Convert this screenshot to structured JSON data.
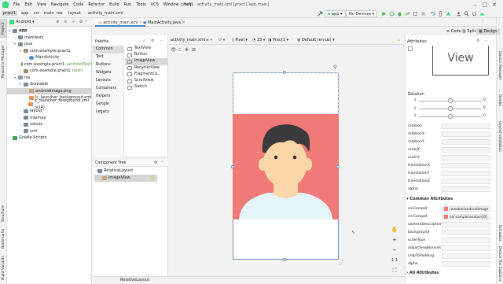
{
  "menu": [
    "File",
    "Edit",
    "View",
    "Navigate",
    "Code",
    "Refactor",
    "Build",
    "Run",
    "Tools",
    "VCS",
    "Window",
    "Help"
  ],
  "window_title": "pract1 - activity_main.xml [pract1.app.main]",
  "breadcrumbs": [
    "pract1",
    "app",
    "src",
    "main",
    "res",
    "layout",
    "activity_main.xml"
  ],
  "toolbar": {
    "run_config": "app",
    "device": "No Devices"
  },
  "project": {
    "view_mode": "Android",
    "tree": [
      {
        "label": "app",
        "indent": 0,
        "icon": "folder",
        "arrow": "▾",
        "bold": true
      },
      {
        "label": "manifests",
        "indent": 1,
        "icon": "folder",
        "arrow": "›"
      },
      {
        "label": "java",
        "indent": 1,
        "icon": "folder",
        "arrow": "▾"
      },
      {
        "label": "com.example.pract1",
        "indent": 2,
        "icon": "pkg",
        "arrow": "▾"
      },
      {
        "label": "MainActivity",
        "indent": 3,
        "icon": "cls",
        "arrow": ""
      },
      {
        "label": "com.example.pract1",
        "suffix": "(androidTest)",
        "indent": 2,
        "icon": "pkg",
        "arrow": "›"
      },
      {
        "label": "com.example.pract1",
        "suffix": "(test)",
        "indent": 2,
        "icon": "pkg",
        "arrow": "›"
      },
      {
        "label": "res",
        "indent": 1,
        "icon": "res",
        "arrow": "▾"
      },
      {
        "label": "drawable",
        "indent": 2,
        "icon": "folder",
        "arrow": "▾"
      },
      {
        "label": "androidimage.png",
        "indent": 3,
        "icon": "img",
        "arrow": "",
        "selected": true
      },
      {
        "label": "ic_launcher_background.xml",
        "indent": 3,
        "icon": "xml",
        "arrow": ""
      },
      {
        "label": "ic_launcher_foreground.xml (v24)",
        "indent": 3,
        "icon": "xml",
        "arrow": ""
      },
      {
        "label": "layout",
        "indent": 2,
        "icon": "folder",
        "arrow": "›"
      },
      {
        "label": "mipmap",
        "indent": 2,
        "icon": "folder",
        "arrow": "›"
      },
      {
        "label": "values",
        "indent": 2,
        "icon": "folder",
        "arrow": "›"
      },
      {
        "label": "xml",
        "indent": 2,
        "icon": "folder",
        "arrow": "›"
      },
      {
        "label": "Gradle Scripts",
        "indent": 0,
        "icon": "gradle",
        "arrow": "›"
      }
    ]
  },
  "left_tabs": [
    "Project",
    "Resource Manager",
    "Structure",
    "Bookmarks",
    "Build Variants"
  ],
  "right_tabs": [
    "Gradle",
    "Device Manager",
    "Layout Validation",
    "Emulator",
    "Device File Explorer"
  ],
  "editor_tabs": [
    "activity_main.xml",
    "MainActivity.java"
  ],
  "view_modes": [
    "Code",
    "Split",
    "Design"
  ],
  "palette": {
    "title": "Palette",
    "categories": [
      "Common",
      "Text",
      "Buttons",
      "Widgets",
      "Layouts",
      "Containers",
      "Helpers",
      "Google",
      "Legacy"
    ],
    "items": [
      "TextView",
      "Button",
      "ImageView",
      "RecyclerView",
      "FragmentCo...",
      "ScrollView",
      "Switch"
    ]
  },
  "component_tree": {
    "title": "Component Tree",
    "items": [
      "RelativeLayout",
      "imageView"
    ]
  },
  "design_toolbar": {
    "file": "activity_main.xml",
    "device": "Pixel",
    "api": "33",
    "theme": "Pract1",
    "locale": "Default (en-us)"
  },
  "attributes": {
    "title": "Attributes",
    "widget_type": "ImageView",
    "preview_label": "View",
    "rotation_title": "Rotation",
    "rotation": [
      {
        "axis": "x",
        "value": "0"
      },
      {
        "axis": "y",
        "value": "0"
      },
      {
        "axis": "z",
        "value": "0"
      }
    ],
    "transform_rows": [
      "rotation",
      "rotationX",
      "rotationY",
      "scaleX",
      "scaleY",
      "translationX",
      "translationY",
      "translationZ",
      "alpha"
    ],
    "common_title": "Common Attributes",
    "common_rows": [
      {
        "key": "srcCompat",
        "value": "rawable/androidimage"
      },
      {
        "key": "srcCompat",
        "value": "ols:sample/avatars[0]"
      },
      {
        "key": "contentDescription",
        "value": ""
      },
      {
        "key": "background",
        "value": ""
      },
      {
        "key": "scaleType",
        "value": ""
      },
      {
        "key": "adjustViewBounds",
        "value": ""
      },
      {
        "key": "cropToPadding",
        "value": ""
      },
      {
        "key": "alpha",
        "value": ""
      }
    ],
    "all_title": "All Attributes"
  },
  "status": "RelativeLayout",
  "colors": {
    "image_bg": "#f07a78",
    "face": "#fbd6a8",
    "hair": "#3a3a3a",
    "shirt": "#e4f5f9",
    "accent": "#4a86c8"
  }
}
